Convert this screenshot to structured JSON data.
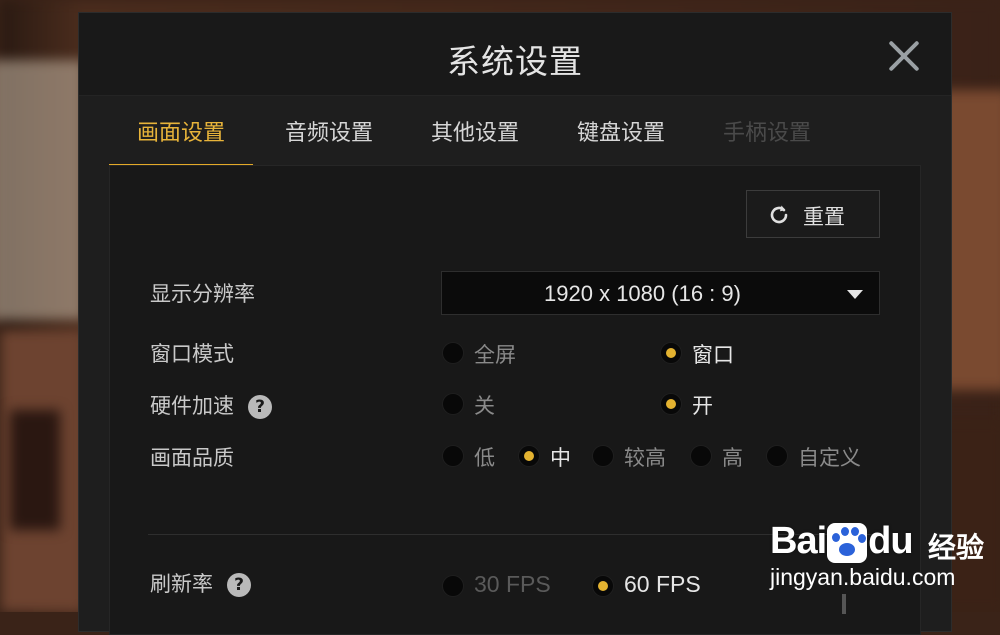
{
  "dialog": {
    "title": "系统设置",
    "close_icon": "close-icon"
  },
  "tabs": [
    {
      "label": "画面设置",
      "state": "active"
    },
    {
      "label": "音频设置",
      "state": "normal"
    },
    {
      "label": "其他设置",
      "state": "normal"
    },
    {
      "label": "键盘设置",
      "state": "normal"
    },
    {
      "label": "手柄设置",
      "state": "disabled"
    }
  ],
  "reset": {
    "label": "重置",
    "icon": "refresh-icon"
  },
  "settings": {
    "resolution": {
      "label": "显示分辨率",
      "value": "1920 x 1080 (16 : 9)"
    },
    "window_mode": {
      "label": "窗口模式",
      "options": [
        "全屏",
        "窗口"
      ],
      "selected": "窗口"
    },
    "hw_accel": {
      "label": "硬件加速",
      "options": [
        "关",
        "开"
      ],
      "selected": "开"
    },
    "quality": {
      "label": "画面品质",
      "options": [
        "低",
        "中",
        "较高",
        "高",
        "自定义"
      ],
      "selected": "中"
    },
    "refresh_rate": {
      "label": "刷新率",
      "options": [
        "30 FPS",
        "60 FPS"
      ],
      "selected": "60 FPS"
    }
  },
  "help_glyph": "?",
  "watermark": {
    "logo_prefix": "Bai",
    "logo_suffix": "du",
    "chinese": "经验",
    "url": "jingyan.baidu.com"
  },
  "colors": {
    "accent": "#e3b230",
    "dialog_bg": "#1e1e1e",
    "panel_bg": "#181818"
  }
}
